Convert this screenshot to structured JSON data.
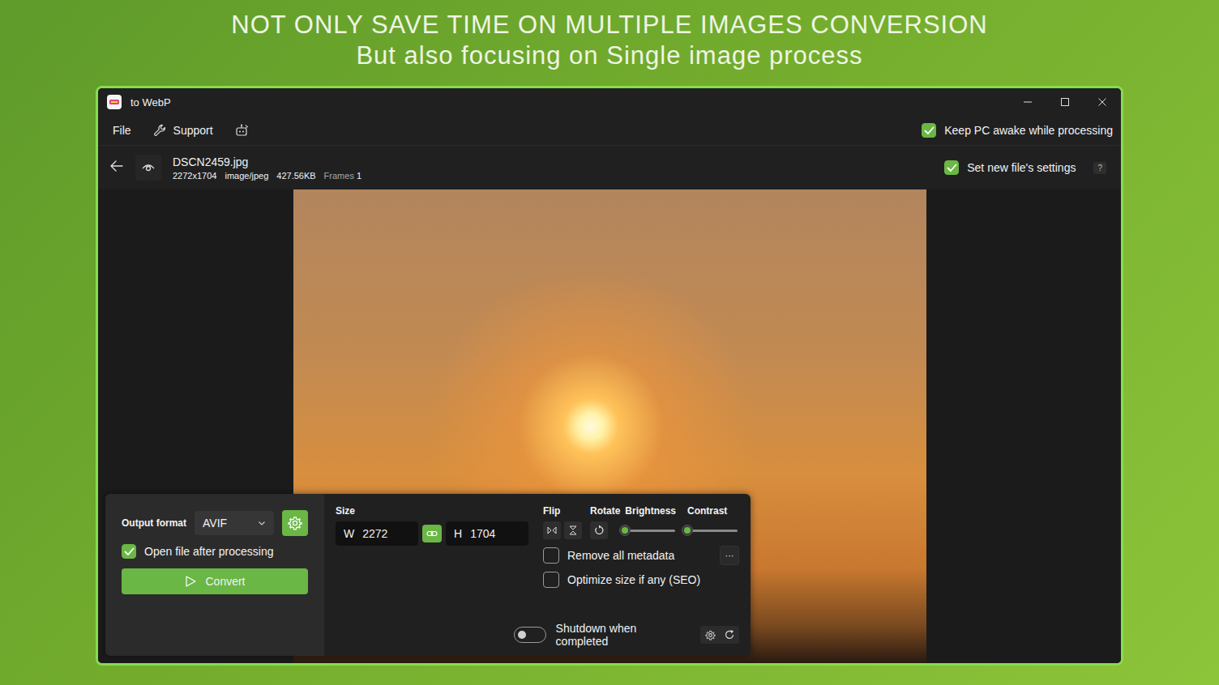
{
  "headline": [
    "NOT ONLY SAVE TIME ON MULTIPLE IMAGES CONVERSION",
    "But also focusing on Single image process"
  ],
  "window": {
    "title": "to WebP"
  },
  "menu": [
    {
      "label": "File"
    },
    {
      "label": "Support"
    }
  ],
  "keep_awake": {
    "label": "Keep PC awake while processing",
    "checked": true
  },
  "file": {
    "name": "DSCN2459.jpg",
    "dimensions": "2272x1704",
    "mime": "image/jpeg",
    "size": "427.56KB",
    "frames_label": "Frames",
    "frames": "1"
  },
  "new_file_settings": {
    "label": "Set new file's settings",
    "checked": true,
    "help": "?"
  },
  "panel": {
    "output_format": {
      "label": "Output format",
      "value": "AVIF"
    },
    "open_after": {
      "label": "Open file after processing",
      "checked": true
    },
    "convert": {
      "label": "Convert"
    },
    "size": {
      "label": "Size",
      "width_prefix": "W",
      "width": "2272",
      "height_prefix": "H",
      "height": "1704",
      "linked": true
    },
    "flip": {
      "label": "Flip"
    },
    "rotate": {
      "label": "Rotate"
    },
    "brightness": {
      "label": "Brightness",
      "level": 0
    },
    "contrast": {
      "label": "Contrast",
      "level": 0
    },
    "options": [
      {
        "label": "Remove all metadata",
        "checked": false
      },
      {
        "label": "Optimize size if any (SEO)",
        "checked": false
      }
    ],
    "more_button": "···",
    "shutdown": {
      "label": "Shutdown when completed",
      "on": false
    }
  }
}
